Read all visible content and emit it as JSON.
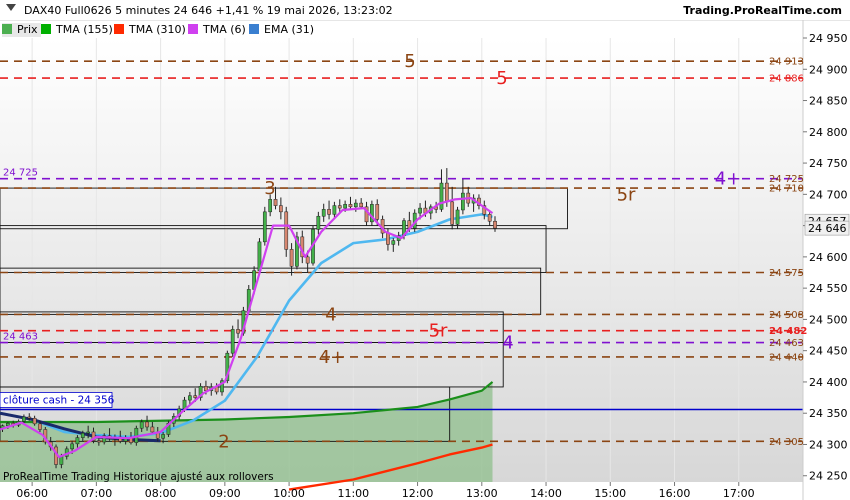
{
  "header": {
    "title": "DAX40 Full0626 5 minutes 24 646 +1,41 % 19 mai 2026, 13:23:02",
    "brand": "Trading.ProRealTime.com"
  },
  "legend": [
    {
      "label": "Prix",
      "color": "#4caf50"
    },
    {
      "label": "TMA (155)",
      "color": "#00b000"
    },
    {
      "label": "TMA (310)",
      "color": "#ff2a00"
    },
    {
      "label": "TMA (6)",
      "color": "#d040f0"
    },
    {
      "label": "EMA (31)",
      "color": "#3a7fd0"
    }
  ],
  "footer_note": "ProRealTime Trading  Historique ajusté aux rollovers",
  "chart_data": {
    "type": "candlestick",
    "ylim": [
      24240,
      24950
    ],
    "xlim": [
      "05:30",
      "18:00"
    ],
    "y_ticks": [
      24250,
      24300,
      24350,
      24400,
      24450,
      24500,
      24550,
      24600,
      24650,
      24700,
      24750,
      24800,
      24850,
      24900,
      24950
    ],
    "y_tick_labels": [
      "24 250",
      "24 300",
      "24 350",
      "24 400",
      "24 450",
      "24 500",
      "24 550",
      "24 600",
      "24 650",
      "24 700",
      "24 750",
      "24 800",
      "24 850",
      "24 900",
      "24 950"
    ],
    "x_ticks": [
      "06:00",
      "07:00",
      "08:00",
      "09:00",
      "10:00",
      "11:00",
      "12:00",
      "13:00",
      "14:00",
      "15:00",
      "16:00",
      "17:00"
    ],
    "last_price": 24646,
    "price_boxes": [
      24657,
      24646
    ],
    "candles": [
      [
        "05:30",
        24326,
        24332,
        24320,
        24330
      ],
      [
        "05:35",
        24330,
        24336,
        24325,
        24334
      ],
      [
        "05:40",
        24334,
        24338,
        24327,
        24331
      ],
      [
        "05:45",
        24331,
        24340,
        24328,
        24337
      ],
      [
        "05:50",
        24337,
        24348,
        24334,
        24344
      ],
      [
        "05:55",
        24344,
        24350,
        24338,
        24342
      ],
      [
        "06:00",
        24342,
        24346,
        24330,
        24333
      ],
      [
        "06:05",
        24333,
        24338,
        24320,
        24324
      ],
      [
        "06:10",
        24324,
        24328,
        24300,
        24304
      ],
      [
        "06:15",
        24304,
        24312,
        24290,
        24296
      ],
      [
        "06:20",
        24296,
        24300,
        24262,
        24268
      ],
      [
        "06:25",
        24268,
        24285,
        24262,
        24281
      ],
      [
        "06:30",
        24281,
        24297,
        24276,
        24293
      ],
      [
        "06:35",
        24293,
        24306,
        24285,
        24301
      ],
      [
        "06:40",
        24301,
        24315,
        24295,
        24311
      ],
      [
        "06:45",
        24311,
        24322,
        24305,
        24318
      ],
      [
        "06:50",
        24318,
        24330,
        24310,
        24320
      ],
      [
        "06:55",
        24320,
        24327,
        24302,
        24306
      ],
      [
        "07:00",
        24306,
        24312,
        24298,
        24304
      ],
      [
        "07:05",
        24304,
        24318,
        24300,
        24314
      ],
      [
        "07:10",
        24314,
        24326,
        24306,
        24309
      ],
      [
        "07:15",
        24309,
        24316,
        24298,
        24312
      ],
      [
        "07:20",
        24312,
        24322,
        24302,
        24305
      ],
      [
        "07:25",
        24305,
        24315,
        24300,
        24311
      ],
      [
        "07:30",
        24311,
        24320,
        24300,
        24303
      ],
      [
        "07:35",
        24303,
        24330,
        24298,
        24326
      ],
      [
        "07:40",
        24326,
        24340,
        24320,
        24336
      ],
      [
        "07:45",
        24336,
        24346,
        24322,
        24328
      ],
      [
        "07:50",
        24328,
        24336,
        24316,
        24320
      ],
      [
        "07:55",
        24320,
        24328,
        24305,
        24310
      ],
      [
        "08:00",
        24310,
        24320,
        24302,
        24316
      ],
      [
        "08:05",
        24316,
        24338,
        24312,
        24334
      ],
      [
        "08:10",
        24334,
        24350,
        24328,
        24345
      ],
      [
        "08:15",
        24345,
        24362,
        24340,
        24357
      ],
      [
        "08:20",
        24357,
        24376,
        24352,
        24371
      ],
      [
        "08:25",
        24371,
        24384,
        24364,
        24378
      ],
      [
        "08:30",
        24378,
        24390,
        24368,
        24375
      ],
      [
        "08:35",
        24375,
        24398,
        24370,
        24393
      ],
      [
        "08:40",
        24393,
        24402,
        24380,
        24386
      ],
      [
        "08:45",
        24386,
        24398,
        24378,
        24392
      ],
      [
        "08:50",
        24392,
        24398,
        24380,
        24384
      ],
      [
        "08:55",
        24384,
        24406,
        24378,
        24402
      ],
      [
        "09:00",
        24402,
        24450,
        24398,
        24446
      ],
      [
        "09:05",
        24446,
        24490,
        24440,
        24484
      ],
      [
        "09:10",
        24484,
        24500,
        24470,
        24478
      ],
      [
        "09:15",
        24478,
        24520,
        24474,
        24514
      ],
      [
        "09:20",
        24514,
        24555,
        24508,
        24548
      ],
      [
        "09:25",
        24548,
        24585,
        24540,
        24578
      ],
      [
        "09:30",
        24578,
        24630,
        24572,
        24624
      ],
      [
        "09:35",
        24624,
        24680,
        24618,
        24672
      ],
      [
        "09:40",
        24672,
        24700,
        24665,
        24692
      ],
      [
        "09:45",
        24692,
        24712,
        24676,
        24682
      ],
      [
        "09:50",
        24682,
        24695,
        24660,
        24672
      ],
      [
        "09:55",
        24672,
        24680,
        24600,
        24612
      ],
      [
        "10:00",
        24612,
        24622,
        24570,
        24585
      ],
      [
        "10:05",
        24585,
        24640,
        24580,
        24632
      ],
      [
        "10:10",
        24632,
        24642,
        24590,
        24600
      ],
      [
        "10:15",
        24600,
        24610,
        24575,
        24590
      ],
      [
        "10:20",
        24590,
        24650,
        24586,
        24644
      ],
      [
        "10:25",
        24644,
        24672,
        24636,
        24665
      ],
      [
        "10:30",
        24665,
        24685,
        24656,
        24676
      ],
      [
        "10:35",
        24676,
        24690,
        24660,
        24668
      ],
      [
        "10:40",
        24668,
        24688,
        24662,
        24682
      ],
      [
        "10:45",
        24682,
        24692,
        24670,
        24678
      ],
      [
        "10:50",
        24678,
        24690,
        24672,
        24684
      ],
      [
        "10:55",
        24684,
        24696,
        24676,
        24680
      ],
      [
        "11:00",
        24680,
        24692,
        24672,
        24686
      ],
      [
        "11:05",
        24686,
        24694,
        24676,
        24680
      ],
      [
        "11:10",
        24680,
        24688,
        24650,
        24656
      ],
      [
        "11:15",
        24656,
        24690,
        24650,
        24684
      ],
      [
        "11:20",
        24684,
        24692,
        24650,
        24660
      ],
      [
        "11:25",
        24660,
        24666,
        24630,
        24638
      ],
      [
        "11:30",
        24638,
        24646,
        24610,
        24620
      ],
      [
        "11:35",
        24620,
        24630,
        24608,
        24626
      ],
      [
        "11:40",
        24626,
        24640,
        24618,
        24634
      ],
      [
        "11:45",
        24634,
        24662,
        24628,
        24658
      ],
      [
        "11:50",
        24658,
        24672,
        24640,
        24646
      ],
      [
        "11:55",
        24646,
        24676,
        24640,
        24670
      ],
      [
        "12:00",
        24670,
        24686,
        24660,
        24678
      ],
      [
        "12:05",
        24678,
        24690,
        24664,
        24670
      ],
      [
        "12:10",
        24670,
        24684,
        24660,
        24680
      ],
      [
        "12:15",
        24680,
        24688,
        24670,
        24676
      ],
      [
        "12:20",
        24676,
        24740,
        24672,
        24718
      ],
      [
        "12:25",
        24718,
        24742,
        24680,
        24688
      ],
      [
        "12:30",
        24688,
        24712,
        24644,
        24652
      ],
      [
        "12:35",
        24652,
        24680,
        24645,
        24675
      ],
      [
        "12:40",
        24675,
        24724,
        24668,
        24702
      ],
      [
        "12:45",
        24702,
        24712,
        24680,
        24686
      ],
      [
        "12:50",
        24686,
        24700,
        24672,
        24694
      ],
      [
        "12:55",
        24694,
        24700,
        24676,
        24682
      ],
      [
        "13:00",
        24682,
        24690,
        24660,
        24668
      ],
      [
        "13:05",
        24668,
        24674,
        24650,
        24657
      ],
      [
        "13:10",
        24657,
        24665,
        24640,
        24646
      ]
    ],
    "tma_155": [
      [
        "05:30",
        24336
      ],
      [
        "07:00",
        24336
      ],
      [
        "08:00",
        24338
      ],
      [
        "09:00",
        24340
      ],
      [
        "10:00",
        24344
      ],
      [
        "11:00",
        24350
      ],
      [
        "12:00",
        24360
      ],
      [
        "12:30",
        24372
      ],
      [
        "13:00",
        24386
      ],
      [
        "13:10",
        24400
      ]
    ],
    "tma_310": [
      [
        "10:00",
        24228
      ],
      [
        "11:00",
        24244
      ],
      [
        "12:00",
        24270
      ],
      [
        "12:30",
        24284
      ],
      [
        "13:00",
        24295
      ],
      [
        "13:10",
        24300
      ]
    ],
    "tma_6": [
      [
        "05:30",
        24324
      ],
      [
        "05:50",
        24335
      ],
      [
        "06:10",
        24315
      ],
      [
        "06:25",
        24280
      ],
      [
        "06:40",
        24290
      ],
      [
        "07:00",
        24312
      ],
      [
        "07:30",
        24310
      ],
      [
        "08:00",
        24320
      ],
      [
        "08:20",
        24352
      ],
      [
        "08:40",
        24382
      ],
      [
        "09:00",
        24400
      ],
      [
        "09:15",
        24470
      ],
      [
        "09:30",
        24560
      ],
      [
        "09:45",
        24650
      ],
      [
        "10:00",
        24650
      ],
      [
        "10:15",
        24600
      ],
      [
        "10:30",
        24640
      ],
      [
        "10:50",
        24675
      ],
      [
        "11:10",
        24678
      ],
      [
        "11:30",
        24640
      ],
      [
        "11:45",
        24630
      ],
      [
        "12:00",
        24660
      ],
      [
        "12:20",
        24685
      ],
      [
        "12:35",
        24692
      ],
      [
        "12:50",
        24694
      ],
      [
        "13:10",
        24670
      ]
    ],
    "ema_31": [
      [
        "05:30",
        24350
      ],
      [
        "06:00",
        24340
      ],
      [
        "06:30",
        24320
      ],
      [
        "07:00",
        24315
      ],
      [
        "07:30",
        24312
      ],
      [
        "08:00",
        24318
      ],
      [
        "08:30",
        24338
      ],
      [
        "09:00",
        24370
      ],
      [
        "09:30",
        24440
      ],
      [
        "10:00",
        24530
      ],
      [
        "10:30",
        24590
      ],
      [
        "11:00",
        24622
      ],
      [
        "11:30",
        24628
      ],
      [
        "12:00",
        24640
      ],
      [
        "12:30",
        24660
      ],
      [
        "13:00",
        24668
      ],
      [
        "13:10",
        24664
      ]
    ],
    "dark_ma": [
      [
        "05:30",
        24350
      ],
      [
        "06:00",
        24340
      ],
      [
        "06:30",
        24325
      ],
      [
        "07:00",
        24312
      ],
      [
        "07:30",
        24308
      ],
      [
        "08:00",
        24306
      ]
    ],
    "horizontal_levels": [
      {
        "value": 24913,
        "color": "#8b4513",
        "label": "24 913",
        "tag": "5"
      },
      {
        "value": 24886,
        "color": "#e82020",
        "label": "24 886",
        "tag": "5"
      },
      {
        "value": 24725,
        "color": "#8010d0",
        "label": "24 725",
        "tag": "4+"
      },
      {
        "value": 24710,
        "color": "#8b4513",
        "label": "24 710",
        "tag": "3"
      },
      {
        "value": 24575,
        "color": "#8b4513",
        "label": "24 575",
        "tag": ""
      },
      {
        "value": 24508,
        "color": "#8b4513",
        "label": "24 508",
        "tag": "4"
      },
      {
        "value": 24482,
        "color": "#e82020",
        "label": "24 482",
        "tag": "5r"
      },
      {
        "value": 24463,
        "color": "#8010d0",
        "label": "24 463",
        "tag": "4"
      },
      {
        "value": 24440,
        "color": "#8b4513",
        "label": "24 440",
        "tag": "4+"
      },
      {
        "value": 24305,
        "color": "#8b4513",
        "label": "24 305",
        "tag": "2"
      }
    ],
    "tag_5r_upper": "5r",
    "cloture_cash": {
      "value": 24356,
      "label": "clôture cash -  24 356"
    },
    "boxes": [
      {
        "x1": "05:30",
        "x2": "14:20",
        "y1": 24645,
        "y2": 24710
      },
      {
        "x1": "05:30",
        "x2": "14:00",
        "y1": 24575,
        "y2": 24650
      },
      {
        "x1": "05:30",
        "x2": "13:55",
        "y1": 24508,
        "y2": 24582
      },
      {
        "x1": "05:30",
        "x2": "13:20",
        "y1": 24463,
        "y2": 24512
      },
      {
        "x1": "05:30",
        "x2": "13:20",
        "y1": 24392,
        "y2": 24463
      },
      {
        "x1": "05:30",
        "x2": "12:30",
        "y1": 24305,
        "y2": 24392
      }
    ],
    "level_left_labels": [
      {
        "value": 24725,
        "label": "24 725",
        "color": "#8010d0"
      },
      {
        "value": 24463,
        "label": "24 463",
        "color": "#8010d0"
      }
    ],
    "tag_positions_note": ""
  }
}
